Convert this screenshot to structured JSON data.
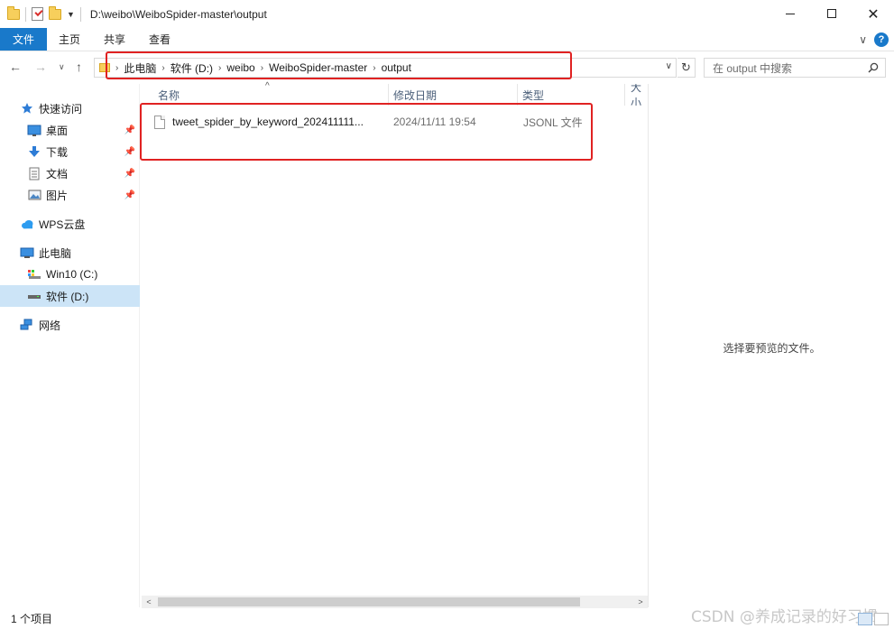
{
  "window": {
    "title": "D:\\weibo\\WeiboSpider-master\\output",
    "controls": {
      "minimize": "—",
      "maximize": "☐",
      "close": "✕"
    }
  },
  "ribbon": {
    "tabs": [
      "文件",
      "主页",
      "共享",
      "查看"
    ]
  },
  "navigation": {
    "breadcrumb": [
      "此电脑",
      "软件 (D:)",
      "weibo",
      "WeiboSpider-master",
      "output"
    ],
    "search_placeholder": "在 output 中搜索"
  },
  "sidebar": {
    "items": [
      {
        "label": "快速访问",
        "icon": "star-icon",
        "pinned": false,
        "indent": false
      },
      {
        "label": "桌面",
        "icon": "desktop-icon",
        "pinned": true,
        "indent": true
      },
      {
        "label": "下载",
        "icon": "download-icon",
        "pinned": true,
        "indent": true
      },
      {
        "label": "文档",
        "icon": "document-icon",
        "pinned": true,
        "indent": true
      },
      {
        "label": "图片",
        "icon": "picture-icon",
        "pinned": true,
        "indent": true
      },
      {
        "label": "WPS云盘",
        "icon": "cloud-icon",
        "pinned": false,
        "indent": false
      },
      {
        "label": "此电脑",
        "icon": "computer-icon",
        "pinned": false,
        "indent": false
      },
      {
        "label": "Win10 (C:)",
        "icon": "drive-icon",
        "pinned": false,
        "indent": true
      },
      {
        "label": "软件 (D:)",
        "icon": "drive-icon",
        "pinned": false,
        "indent": true,
        "selected": true
      },
      {
        "label": "网络",
        "icon": "network-icon",
        "pinned": false,
        "indent": false
      }
    ]
  },
  "file_list": {
    "columns": [
      "名称",
      "修改日期",
      "类型",
      "大小"
    ],
    "rows": [
      {
        "name": "tweet_spider_by_keyword_202411111...",
        "modified": "2024/11/11 19:54",
        "type": "JSONL 文件"
      }
    ]
  },
  "preview": {
    "message": "选择要预览的文件。"
  },
  "status": {
    "item_count": "1 个项目"
  },
  "watermark": "CSDN @养成记录的好习惯",
  "colors": {
    "accent": "#1979ca",
    "highlight_box": "#e02222",
    "selected_bg": "#cce4f7"
  }
}
